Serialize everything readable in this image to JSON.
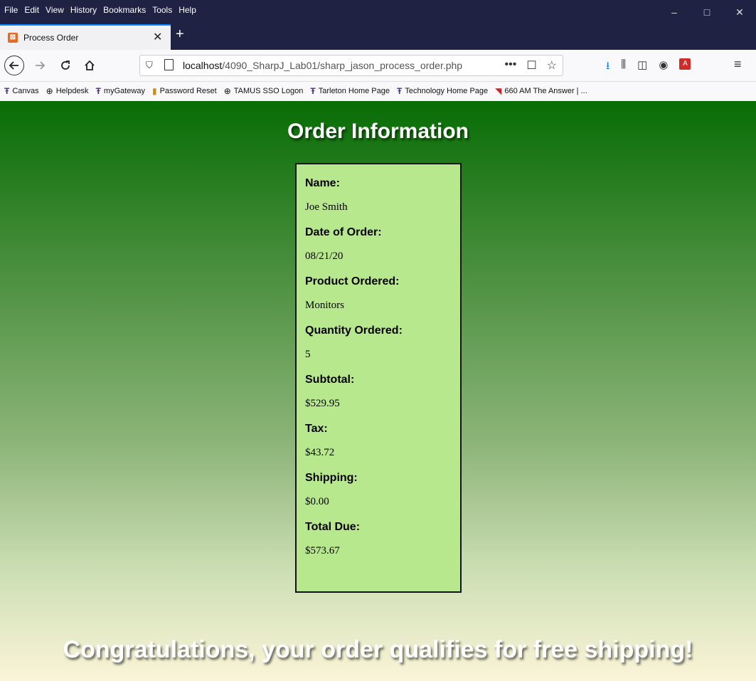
{
  "menu": [
    "File",
    "Edit",
    "View",
    "History",
    "Bookmarks",
    "Tools",
    "Help"
  ],
  "window_controls": {
    "minimize": "–",
    "maximize": "□",
    "close": "✕"
  },
  "tab": {
    "title": "Process Order",
    "close": "✕",
    "new_tab": "+"
  },
  "url": {
    "host": "localhost",
    "path": "/4090_SharpJ_Lab01/sharp_jason_process_order.php"
  },
  "bookmarks": [
    {
      "label": "Canvas",
      "icon": "tarleton-icon"
    },
    {
      "label": "Helpdesk",
      "icon": "globe-icon"
    },
    {
      "label": "myGateway",
      "icon": "tarleton-icon"
    },
    {
      "label": "Password Reset",
      "icon": "lock-icon"
    },
    {
      "label": "TAMUS SSO  Logon",
      "icon": "globe-icon"
    },
    {
      "label": "Tarleton Home Page",
      "icon": "tarleton-icon"
    },
    {
      "label": "Technology Home Page",
      "icon": "tarleton-icon"
    },
    {
      "label": "660 AM The Answer | ...",
      "icon": "radio-icon"
    }
  ],
  "page": {
    "title": "Order Information",
    "fields": [
      {
        "label": "Name:",
        "value": "Joe Smith"
      },
      {
        "label": "Date of Order:",
        "value": "08/21/20"
      },
      {
        "label": "Product Ordered:",
        "value": "Monitors"
      },
      {
        "label": "Quantity Ordered:",
        "value": "5"
      },
      {
        "label": "Subtotal:",
        "value": "$529.95"
      },
      {
        "label": "Tax:",
        "value": "$43.72"
      },
      {
        "label": "Shipping:",
        "value": "$0.00"
      },
      {
        "label": "Total Due:",
        "value": "$573.67"
      }
    ],
    "message": "Congratulations, your order qualifies for free shipping!"
  }
}
